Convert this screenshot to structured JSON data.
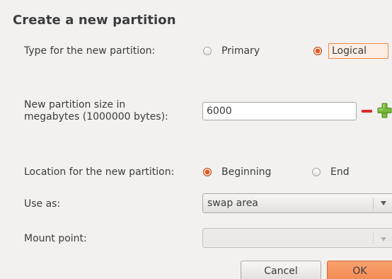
{
  "dialog": {
    "title": "Create a new partition"
  },
  "partition_type": {
    "label": "Type for the new partition:",
    "options": [
      {
        "label": "Primary",
        "selected": false
      },
      {
        "label": "Logical",
        "selected": true
      }
    ]
  },
  "size": {
    "label_line1": "New partition size in",
    "label_line2": "megabytes (1000000 bytes):",
    "value": "6000",
    "decrement_icon": "minus-icon",
    "increment_icon": "plus-icon"
  },
  "location": {
    "label": "Location for the new partition:",
    "options": [
      {
        "label": "Beginning",
        "selected": true
      },
      {
        "label": "End",
        "selected": false
      }
    ]
  },
  "use_as": {
    "label": "Use as:",
    "value": "swap area"
  },
  "mount_point": {
    "label": "Mount point:",
    "value": ""
  },
  "buttons": {
    "cancel": "Cancel",
    "ok": "OK"
  },
  "colors": {
    "accent": "#f28a52",
    "selected_radio": "#e05a1c",
    "minus": "#d92b2b",
    "plus": "#79b93a"
  }
}
